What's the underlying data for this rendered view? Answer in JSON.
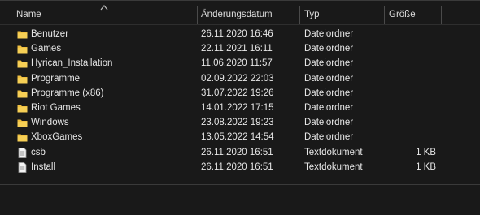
{
  "columns": {
    "name": "Name",
    "date": "Änderungsdatum",
    "type": "Typ",
    "size": "Größe"
  },
  "files": [
    {
      "name": "Benutzer",
      "date": "26.11.2020 16:46",
      "type": "Dateiordner",
      "size": "",
      "icon": "folder-icon"
    },
    {
      "name": "Games",
      "date": "22.11.2021 16:11",
      "type": "Dateiordner",
      "size": "",
      "icon": "folder-icon"
    },
    {
      "name": "Hyrican_Installation",
      "date": "11.06.2020 11:57",
      "type": "Dateiordner",
      "size": "",
      "icon": "folder-icon"
    },
    {
      "name": "Programme",
      "date": "02.09.2022 22:03",
      "type": "Dateiordner",
      "size": "",
      "icon": "folder-icon"
    },
    {
      "name": "Programme (x86)",
      "date": "31.07.2022 19:26",
      "type": "Dateiordner",
      "size": "",
      "icon": "folder-icon"
    },
    {
      "name": "Riot Games",
      "date": "14.01.2022 17:15",
      "type": "Dateiordner",
      "size": "",
      "icon": "folder-icon"
    },
    {
      "name": "Windows",
      "date": "23.08.2022 19:23",
      "type": "Dateiordner",
      "size": "",
      "icon": "folder-icon"
    },
    {
      "name": "XboxGames",
      "date": "13.05.2022 14:54",
      "type": "Dateiordner",
      "size": "",
      "icon": "folder-icon"
    },
    {
      "name": "csb",
      "date": "26.11.2020 16:51",
      "type": "Textdokument",
      "size": "1 KB",
      "icon": "text-document-icon"
    },
    {
      "name": "Install",
      "date": "26.11.2020 16:51",
      "type": "Textdokument",
      "size": "1 KB",
      "icon": "text-document-icon"
    }
  ],
  "colors": {
    "background": "#191919",
    "text": "#e6e6e6",
    "folder": "#f0c040"
  }
}
